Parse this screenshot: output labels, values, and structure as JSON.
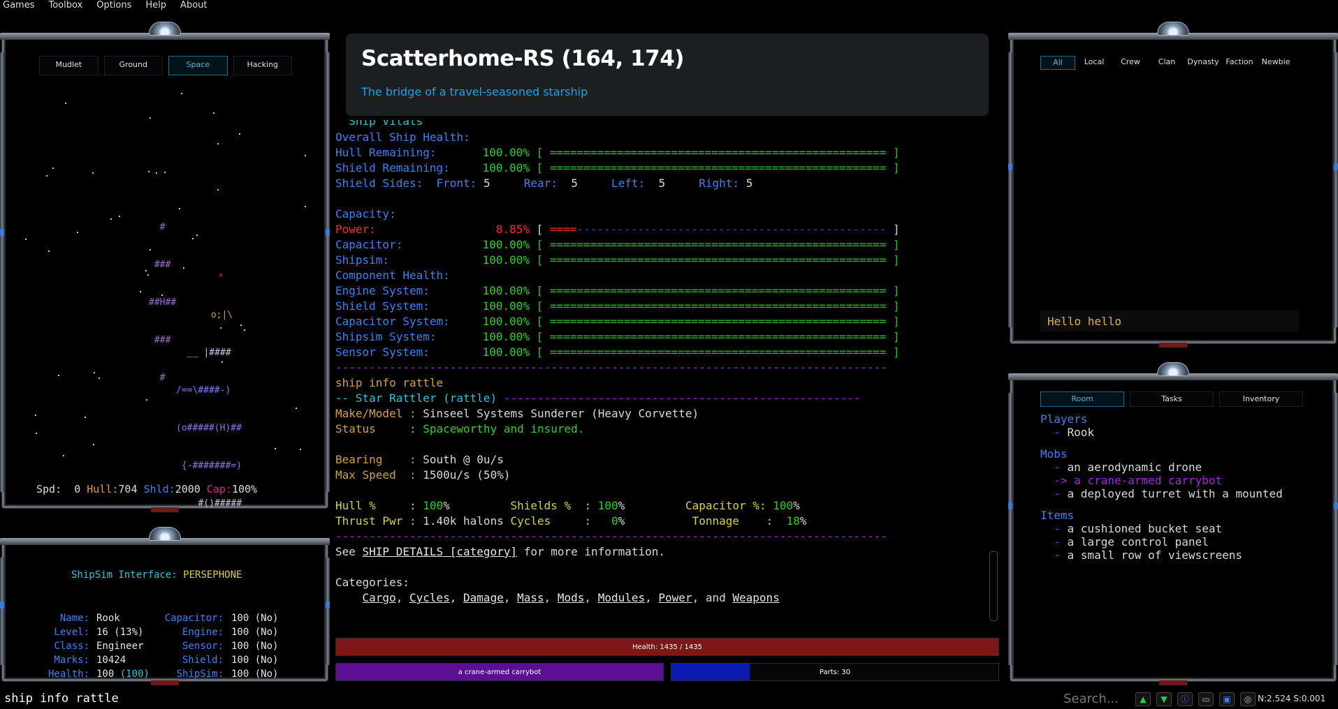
{
  "menu": [
    "Games",
    "Toolbox",
    "Options",
    "Help",
    "About"
  ],
  "map": {
    "tabs": [
      {
        "label": "Mudlet",
        "active": false
      },
      {
        "label": "Ground",
        "active": false
      },
      {
        "label": "Space",
        "active": true
      },
      {
        "label": "Hacking",
        "active": false
      }
    ],
    "planet": [
      "  #",
      " ###",
      "##H##",
      " ###",
      "  #"
    ],
    "ship_star": "*",
    "ship": [
      " o;|\\",
      "__ |####",
      "/==\\####-)",
      "(o#####(H)##",
      " {-#######=)",
      "   #()#####"
    ],
    "status": {
      "spd_label": "Spd:",
      "spd": "0",
      "hull_label": "Hull:",
      "hull": "704",
      "shld_label": "Shld:",
      "shld": "2000",
      "cap_label": "Cap:",
      "cap": "100%"
    }
  },
  "shipsim": {
    "title_label": "ShipSim Interface:",
    "title_value": "PERSEPHONE",
    "left": [
      {
        "label": "Name:",
        "value": "Rook"
      },
      {
        "label": "Level:",
        "value": "16 (13%)"
      },
      {
        "label": "Class:",
        "value": "Engineer"
      },
      {
        "label": "Marks:",
        "value": "10424"
      },
      {
        "label": "Health:",
        "value": "100",
        "extra": "(100)"
      }
    ],
    "right": [
      {
        "label": "Capacitor:",
        "value": "100 (No)"
      },
      {
        "label": "Engine:",
        "value": "100 (No)"
      },
      {
        "label": "Sensor:",
        "value": "100 (No)"
      },
      {
        "label": "Shield:",
        "value": "100 (No)"
      },
      {
        "label": "ShipSim:",
        "value": "100 (No)"
      }
    ]
  },
  "room": {
    "title": "Scatterhome-RS (164, 174)",
    "subtitle": "The bridge of a travel-seasoned starship"
  },
  "terminal": {
    "vitals_heading": "  Ship Vitals",
    "overall": "Overall Ship Health:",
    "hull_label": "Hull Remaining:",
    "hull_pct": "100.00%",
    "shield_label": "Shield Remaining:",
    "shield_pct": "100.00%",
    "sides_label": "Shield Sides:",
    "sides": {
      "front_label": "Front:",
      "front": "5",
      "rear_label": "Rear:",
      "rear": "5",
      "left_label": "Left:",
      "left": "5",
      "right_label": "Right:",
      "right": "5"
    },
    "capacity_label": "Capacity:",
    "power_label": "Power:",
    "power_pct": "8.85%",
    "capacitor_label": "Capacitor:",
    "capacitor_pct": "100.00%",
    "shipsim_label": "Shipsim:",
    "shipsim_pct": "100.00%",
    "component_label": "Component Health:",
    "components": [
      {
        "label": "Engine System:",
        "pct": "100.00%"
      },
      {
        "label": "Shield System:",
        "pct": "100.00%"
      },
      {
        "label": "Capacitor System:",
        "pct": "100.00%"
      },
      {
        "label": "Shipsim System:",
        "pct": "100.00%"
      },
      {
        "label": "Sensor System:",
        "pct": "100.00%"
      }
    ],
    "full_bar": "[ ================================================== ]",
    "power_bar_fill": "====",
    "power_bar_rest": "----------------------------------------------",
    "divider": "----------------------------------------------------------------------------------",
    "command": "ship info rattle",
    "ship_header": "-- Star Rattler (rattle) ",
    "ship_header_tail": "-----------------------------------------------------",
    "make_label": "Make/Model : ",
    "make_value": "Sinseel Systems Sunderer (Heavy Corvette)",
    "status_label": "Status     : ",
    "status_value": "Spaceworthy and insured.",
    "bearing_label": "Bearing    : ",
    "bearing_value": "South @ 0u/s",
    "maxspeed_label": "Max Speed  : ",
    "maxspeed_value": "1500u/s (50%)",
    "hullp_label": "Hull %     : ",
    "hullp_value": "100",
    "shieldsp_label": "Shields %  : ",
    "shieldsp_value": "100",
    "capp_label": "Capacitor %: ",
    "capp_value": "100",
    "thrust_label": "Thrust Pwr : ",
    "thrust_value": "1.40k halons",
    "cycles_label": "Cycles     :   ",
    "cycles_value": "0",
    "tonnage_label": "Tonnage    :  ",
    "tonnage_value": "18",
    "pct": "%",
    "see_pre": "See ",
    "see_link": "SHIP DETAILS [category]",
    "see_post": " for more information.",
    "categories_label": "Categories:",
    "categories": [
      "Cargo",
      "Cycles",
      "Damage",
      "Mass",
      "Mods",
      "Modules",
      "Power"
    ],
    "categories_and": "and",
    "categories_last": "Weapons"
  },
  "bars": {
    "health": "Health: 1435 / 1435",
    "target": "a crane-armed carrybot",
    "parts": "Parts: 30",
    "parts_fraction": 0.24
  },
  "chat": {
    "tabs": [
      {
        "label": "All",
        "active": true
      },
      {
        "label": "Local"
      },
      {
        "label": "Crew"
      },
      {
        "label": "Clan"
      },
      {
        "label": "Dynasty"
      },
      {
        "label": "Faction"
      },
      {
        "label": "Newbie"
      }
    ],
    "input_value": "Hello hello"
  },
  "room_panel": {
    "tabs": [
      {
        "label": "Room",
        "active": true
      },
      {
        "label": "Tasks"
      },
      {
        "label": "Inventory"
      }
    ],
    "players_label": "Players",
    "players": [
      "Rook"
    ],
    "mobs_label": "Mobs",
    "mobs": [
      "an aerodynamic drone",
      "a crane-armed carrybot",
      "a deployed turret with a mounted"
    ],
    "selected_mob": "a crane-armed carrybot",
    "items_label": "Items",
    "items": [
      "a cushioned bucket seat",
      "a large control panel",
      "a small row of viewscreens"
    ]
  },
  "bottom": {
    "command_line": "ship info rattle",
    "search_placeholder": "Search...",
    "netstat": "N:2.524 S:0.001",
    "tray_icons": [
      "up-arrow-icon",
      "down-arrow-icon",
      "info-icon",
      "controller-icon",
      "window-icon",
      "settings-icon"
    ]
  }
}
